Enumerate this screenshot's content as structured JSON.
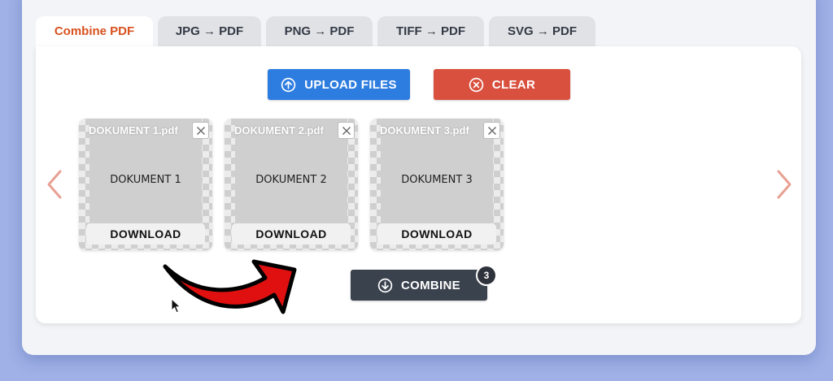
{
  "tabs": [
    {
      "label": "Combine PDF",
      "active": true
    },
    {
      "label": "JPG → PDF",
      "active": false
    },
    {
      "label": "PNG → PDF",
      "active": false
    },
    {
      "label": "TIFF → PDF",
      "active": false
    },
    {
      "label": "SVG → PDF",
      "active": false
    }
  ],
  "toolbar": {
    "upload_label": "UPLOAD FILES",
    "upload_icon": "upload-circle-icon",
    "clear_label": "CLEAR",
    "clear_icon": "clear-circle-icon"
  },
  "files": [
    {
      "filename": "DOKUMENT 1.pdf",
      "page_text": "DOKUMENT 1",
      "download_label": "DOWNLOAD"
    },
    {
      "filename": "DOKUMENT 2.pdf",
      "page_text": "DOKUMENT 2",
      "download_label": "DOWNLOAD"
    },
    {
      "filename": "DOKUMENT 3.pdf",
      "page_text": "DOKUMENT 3",
      "download_label": "DOWNLOAD"
    }
  ],
  "combine": {
    "label": "COMBINE",
    "icon": "download-circle-icon",
    "count": "3"
  },
  "colors": {
    "active_tab": "#d8511f",
    "upload": "#2d7de0",
    "clear": "#d9503f",
    "combine": "#3a424e",
    "nav_arrow": "#e8a093",
    "annotation_arrow": "#e01010"
  },
  "icons": {
    "prev": "chevron-left-icon",
    "next": "chevron-right-icon",
    "annotation": "curved-arrow-icon",
    "pointer": "mouse-cursor-icon"
  }
}
